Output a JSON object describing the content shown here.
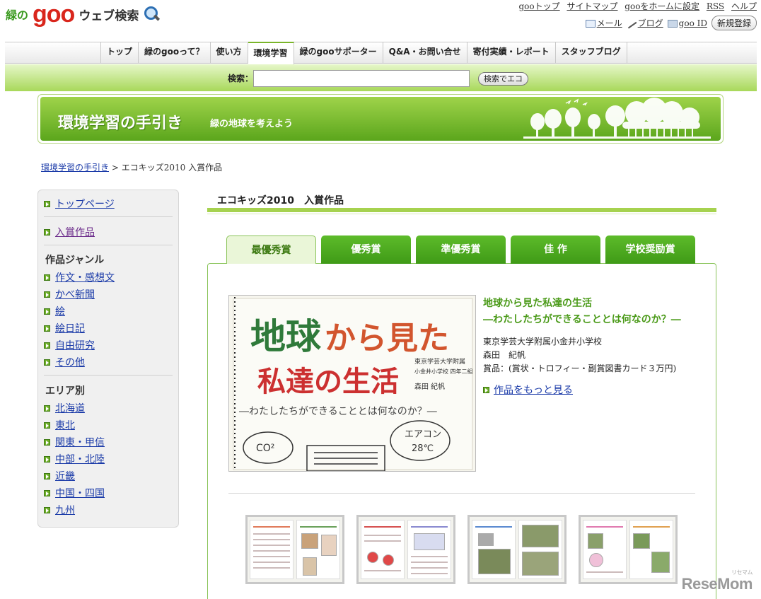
{
  "header": {
    "logo_midori": "緑の",
    "logo_goo": "goo",
    "logo_websearch": "ウェブ検索",
    "top_links": [
      "gooトップ",
      "サイトマップ",
      "gooをホームに設定",
      "RSS",
      "ヘルプ"
    ],
    "mail": "メール",
    "blog": "ブログ",
    "goo_id": "goo ID",
    "register": "新規登録"
  },
  "nav": {
    "tabs": [
      "トップ",
      "緑のgooって？",
      "使い方",
      "環境学習",
      "緑のgooサポーター",
      "Q&A・お問い合せ",
      "寄付実績・レポート",
      "スタッフブログ"
    ],
    "active_index": 3
  },
  "search": {
    "label": "検索：",
    "value": "",
    "button": "検索でエコ"
  },
  "banner": {
    "title": "環境学習の手引き",
    "subtitle": "緑の地球を考えよう"
  },
  "breadcrumb": {
    "parent": "環境学習の手引き",
    "separator": ">",
    "current": "エコキッズ2010 入賞作品"
  },
  "sidebar": {
    "top_page": "トップページ",
    "award_works": "入賞作品",
    "genre_heading": "作品ジャンル",
    "genres": [
      "作文・感想文",
      "かべ新聞",
      "絵",
      "絵日記",
      "自由研究",
      "その他"
    ],
    "area_heading": "エリア別",
    "areas": [
      "北海道",
      "東北",
      "関東・甲信",
      "中部・北陸",
      "近畿",
      "中国・四国",
      "九州"
    ]
  },
  "main": {
    "section_title": "エコキッズ2010　入賞作品",
    "award_tabs": [
      "最優秀賞",
      "優秀賞",
      "準優秀賞",
      "佳 作",
      "学校奨励賞"
    ],
    "active_award": 0,
    "work": {
      "title_line1": "地球から見た私達の生活",
      "title_line2": "―わたしたちができることとは何なのか？―",
      "school": "東京学芸大学附属小金井小学校",
      "name": "森田　紀帆",
      "prize": "賞品：(賞状・トロフィー・副賞図書カード３万円)",
      "more_link": "作品をもっと見る"
    },
    "image_text": {
      "line1a": "地球",
      "line1b": "から見た",
      "line2": "私達の生活",
      "line3": "―わたしたちができることとは何なのか？―",
      "side_school": "東京学芸大学附属",
      "side_grade": "小金井小学校 四年二組",
      "side_name": "森田 紀帆",
      "bubble_left": "CO²",
      "bubble_right_1": "エアコン",
      "bubble_right_2": "28℃"
    }
  },
  "watermark": {
    "text": "ReseMom",
    "ruby": "リセマム"
  },
  "colors": {
    "accent_green": "#5dbb2a",
    "title_green": "#4a9a18",
    "logo_red": "#d9261c",
    "link_blue": "#1a3aa8"
  }
}
